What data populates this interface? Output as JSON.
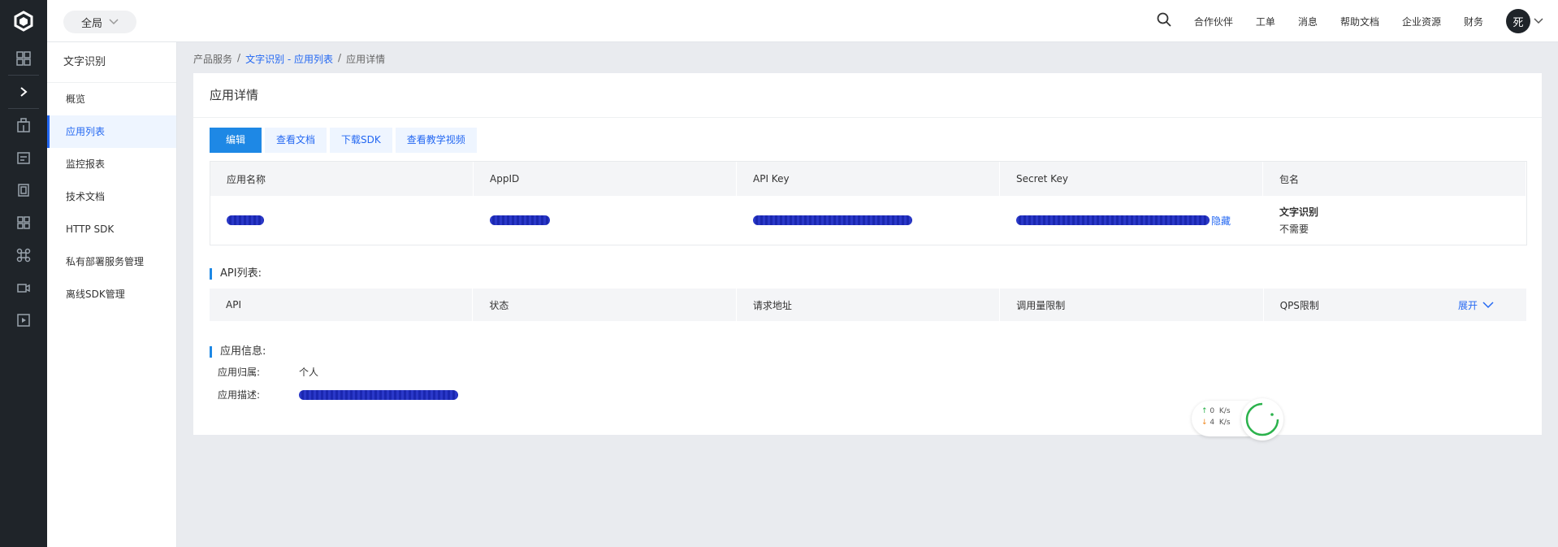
{
  "topbar": {
    "scope_label": "全局",
    "nav": [
      "合作伙伴",
      "工单",
      "消息",
      "帮助文档",
      "企业资源",
      "财务"
    ],
    "avatar_text": "死"
  },
  "sidemenu": {
    "title": "文字识别",
    "items": [
      {
        "label": "概览"
      },
      {
        "label": "应用列表"
      },
      {
        "label": "监控报表"
      },
      {
        "label": "技术文档"
      },
      {
        "label": "HTTP SDK"
      },
      {
        "label": "私有部署服务管理"
      },
      {
        "label": "离线SDK管理"
      }
    ]
  },
  "breadcrumb": {
    "root": "产品服务",
    "sep": "/",
    "link": "文字识别 - 应用列表",
    "current": "应用详情"
  },
  "detail": {
    "title": "应用详情",
    "buttons": [
      "编辑",
      "查看文档",
      "下载SDK",
      "查看教学视频"
    ],
    "table_headers": [
      "应用名称",
      "AppID",
      "API Key",
      "Secret Key",
      "包名"
    ],
    "hide_link": "隐藏",
    "package_name": "文字识别",
    "package_note": "不需要",
    "api_section_title": "API列表:",
    "api_headers": [
      "API",
      "状态",
      "请求地址",
      "调用量限制",
      "QPS限制"
    ],
    "expand_label": "展开",
    "info_section_title": "应用信息:",
    "owner_label": "应用归属:",
    "owner_value": "个人",
    "desc_label": "应用描述:"
  },
  "speed": {
    "up_value": "0",
    "down_value": "4",
    "unit": "K/s"
  },
  "colors": {
    "accent": "#2468f2",
    "primary_button": "#1e88e5",
    "rail_bg": "#1f2429"
  }
}
